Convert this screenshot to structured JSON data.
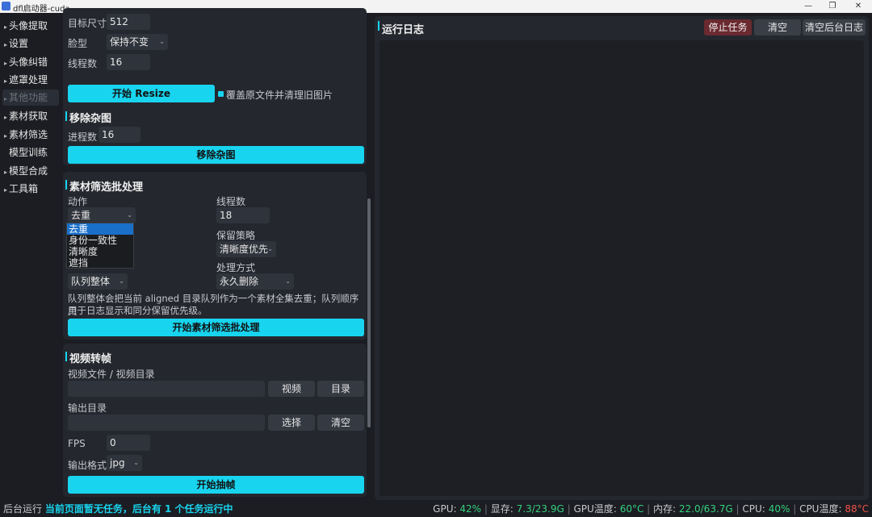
{
  "window": {
    "title": "dfl启动器-cuda"
  },
  "sidebar": {
    "items": [
      {
        "label": "头像提取"
      },
      {
        "label": "设置"
      },
      {
        "label": "头像纠错"
      },
      {
        "label": "遮罩处理"
      },
      {
        "label": "其他功能"
      },
      {
        "label": "素材获取"
      },
      {
        "label": "素材筛选"
      },
      {
        "label": "模型训练"
      },
      {
        "label": "模型合成"
      },
      {
        "label": "工具箱"
      }
    ]
  },
  "resize": {
    "target_size_label": "目标尺寸",
    "target_size_value": "512",
    "face_type_label": "脸型",
    "face_type_value": "保持不变",
    "threads_label": "线程数",
    "threads_value": "16",
    "start_button": "开始 Resize",
    "overwrite_label": "覆盖原文件并清理旧图片"
  },
  "remove": {
    "title": "移除杂图",
    "procs_label": "进程数",
    "procs_value": "16",
    "button": "移除杂图"
  },
  "filter": {
    "title": "素材筛选批处理",
    "action_label": "动作",
    "action_value": "去重",
    "action_options": [
      "去重",
      "身份一致性",
      "清晰度",
      "遮挡"
    ],
    "threads_label": "线程数",
    "threads_value": "18",
    "keep_label": "保留策略",
    "keep_value": "清晰度优先",
    "scope_value": "队列整体",
    "mode_label": "处理方式",
    "mode_value": "永久删除",
    "desc_line1": "队列整体会把当前 aligned 目录队列作为一个素材全集去重；队列顺序只",
    "desc_line2": "用于日志显示和同分保留优先级。",
    "button": "开始素材筛选批处理"
  },
  "video": {
    "title": "视频转帧",
    "file_label": "视频文件 / 视频目录",
    "file_value": "",
    "video_button": "视频",
    "dir_button": "目录",
    "output_label": "输出目录",
    "output_value": "",
    "select_button": "选择",
    "clear_button": "清空",
    "fps_label": "FPS",
    "fps_value": "0",
    "format_label": "输出格式",
    "format_value": "jpg",
    "button": "开始抽帧"
  },
  "log": {
    "title": "运行日志",
    "stop_button": "停止任务",
    "clear_button": "清空",
    "clear_bg_button": "清空后台日志"
  },
  "status": {
    "left_prefix": "后台运行",
    "left_highlight": "当前页面暂无任务，后台有 1 个任务运行中",
    "gpu_label": "GPU:",
    "gpu_value": "42%",
    "vram_label": "显存:",
    "vram_value": "7.3/23.9G",
    "gputemp_label": "GPU温度:",
    "gputemp_value": "60°C",
    "mem_label": "内存:",
    "mem_value": "22.0/63.7G",
    "cpu_label": "CPU:",
    "cpu_value": "40%",
    "cputemp_label": "CPU温度:",
    "cputemp_value": "88°C"
  },
  "colors": {
    "accent": "#18d4ef",
    "ok": "#35d07f",
    "hot": "#f0524a",
    "stop": "#6a2a30"
  }
}
